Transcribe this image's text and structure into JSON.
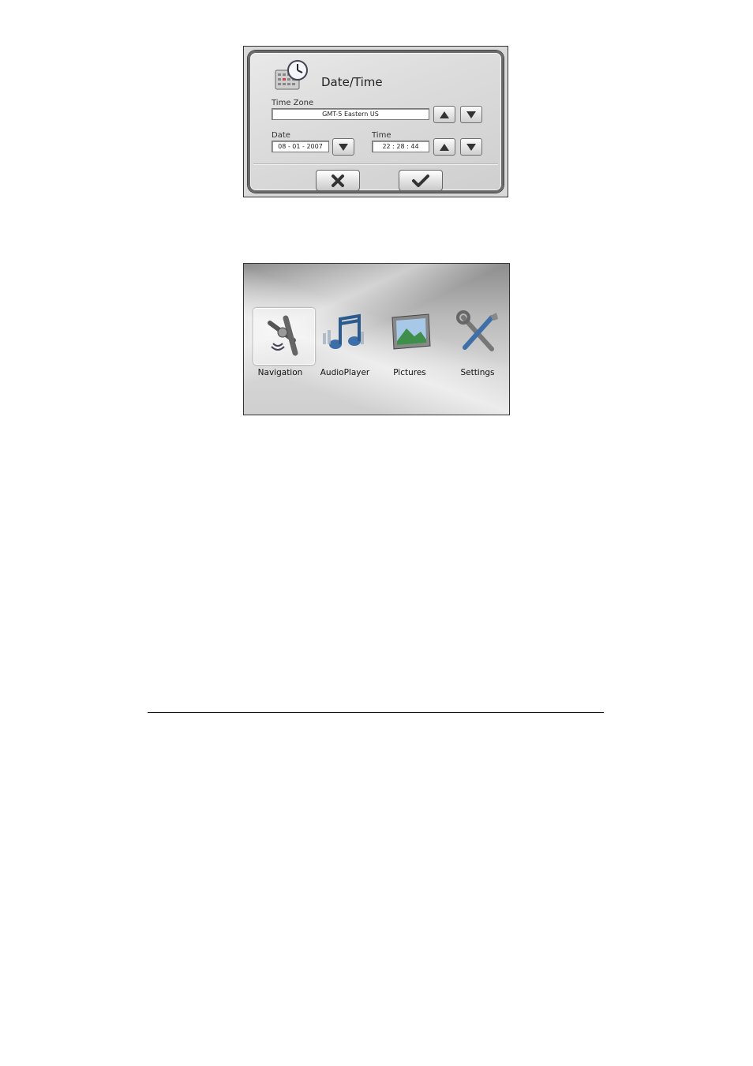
{
  "datetime_dialog": {
    "title": "Date/Time",
    "time_zone_label": "Time Zone",
    "time_zone_value": "GMT-5 Eastern US",
    "date_label": "Date",
    "date_value": "08 - 01 - 2007",
    "time_label": "Time",
    "time_value": "22 : 28 : 44",
    "icons": {
      "header": "calendar-clock-icon",
      "up": "arrow-up-icon",
      "down": "arrow-down-icon",
      "cancel": "close-icon",
      "ok": "checkmark-icon"
    }
  },
  "main_menu": {
    "items": [
      {
        "label": "Navigation",
        "icon": "navigation-icon",
        "selected": true
      },
      {
        "label": "AudioPlayer",
        "icon": "music-notes-icon",
        "selected": false
      },
      {
        "label": "Pictures",
        "icon": "picture-frame-icon",
        "selected": false
      },
      {
        "label": "Settings",
        "icon": "wrench-screwdriver-icon",
        "selected": false
      }
    ]
  }
}
